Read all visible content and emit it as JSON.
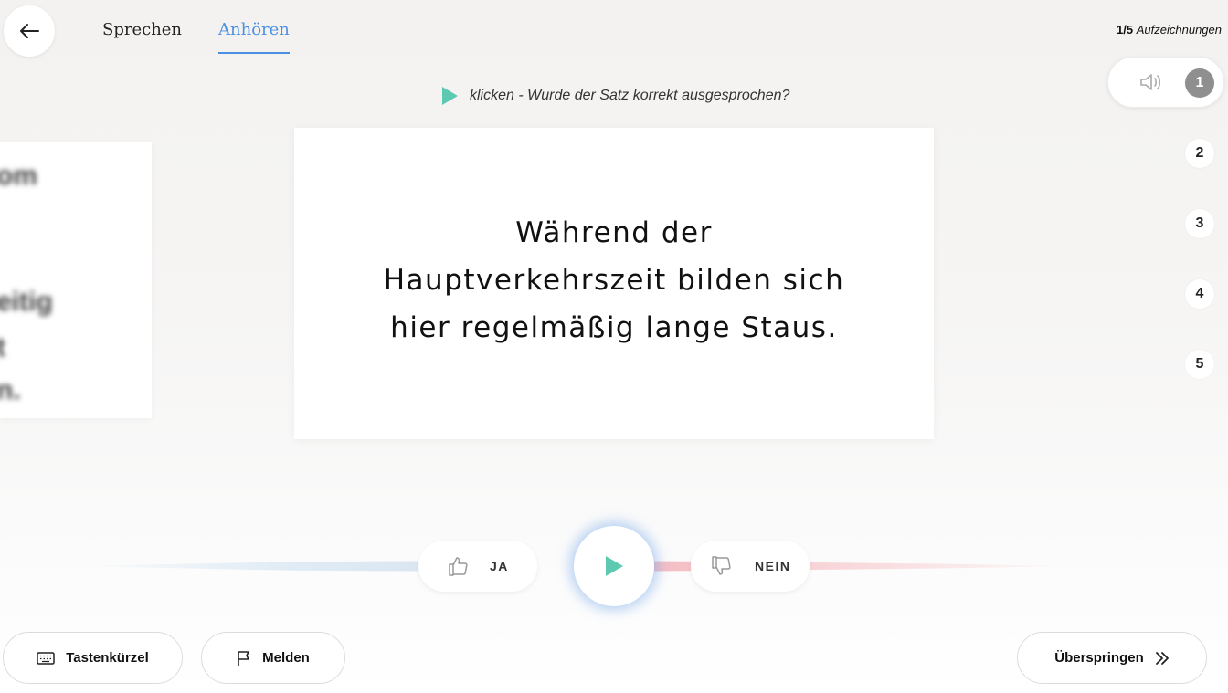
{
  "header": {
    "back_icon": "arrow-left-icon",
    "tabs": [
      {
        "label": "Sprechen",
        "active": false
      },
      {
        "label": "Anhören",
        "active": true
      }
    ],
    "counter": {
      "current": "1/5",
      "label": "Aufzeichnungen"
    }
  },
  "recordings": {
    "items": [
      "1",
      "2",
      "3",
      "4",
      "5"
    ],
    "current": "1",
    "speaker_icon": "speaker-icon"
  },
  "instruction": {
    "icon": "play-icon",
    "text": "klicken - Wurde der Satz korrekt ausgesprochen?"
  },
  "card": {
    "sentence": "Während der Hauptverkehrszeit bilden sich hier regelmäßig lange Staus."
  },
  "controls": {
    "yes_label": "JA",
    "no_label": "NEIN",
    "yes_icon": "thumbs-up-icon",
    "no_icon": "thumbs-down-icon",
    "play_icon": "play-icon"
  },
  "footer": {
    "shortcuts_label": "Tastenkürzel",
    "report_label": "Melden",
    "skip_label": "Überspringen"
  },
  "colors": {
    "accent_blue": "#4a90e2",
    "play_teal": "#5cc9b0",
    "active_number_bg": "#8f8f8f"
  }
}
